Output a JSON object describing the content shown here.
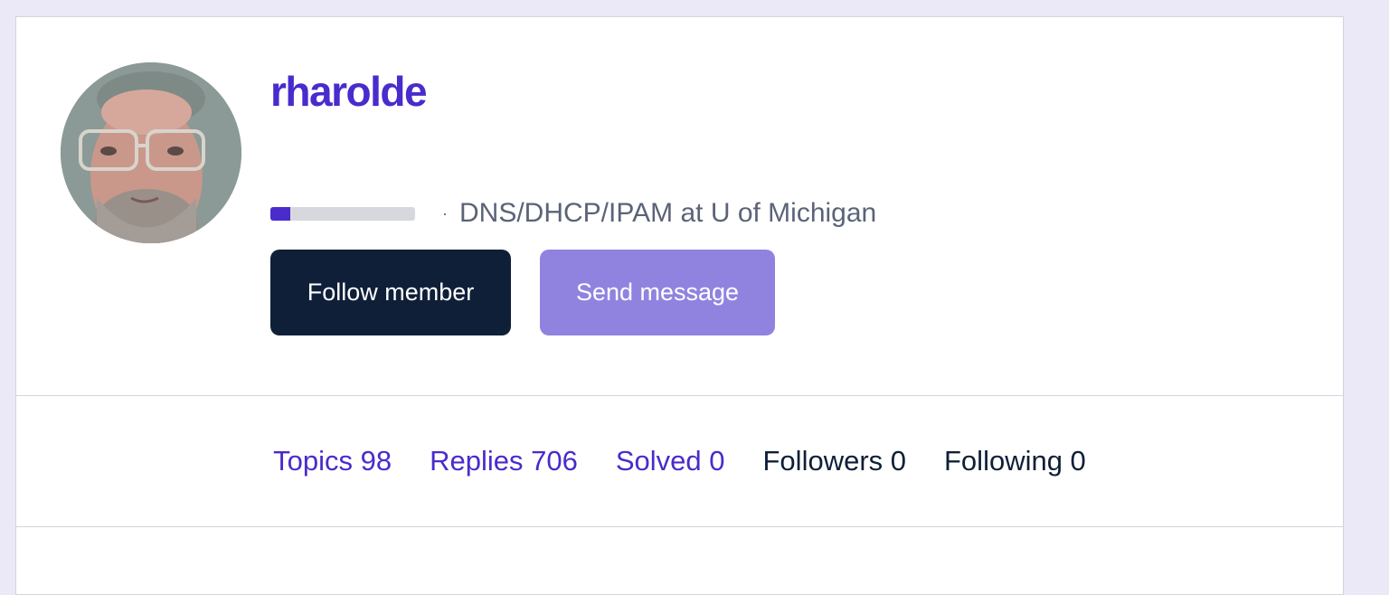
{
  "profile": {
    "username": "rharolde",
    "rank_progress_percent": 14,
    "separator": "·",
    "tagline": "DNS/DHCP/IPAM at U of Michigan",
    "follow_label": "Follow member",
    "message_label": "Send message"
  },
  "stats": {
    "topics": "Topics 98",
    "replies": "Replies 706",
    "solved": "Solved 0",
    "followers": "Followers 0",
    "following": "Following 0"
  },
  "colors": {
    "accent": "#4a2bcc",
    "dark": "#0f1f38",
    "muted_button": "#9083e0",
    "page_background": "#ebe8f8"
  }
}
